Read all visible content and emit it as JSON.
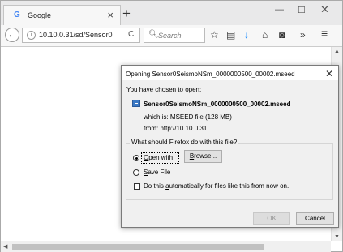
{
  "browser": {
    "tab": {
      "icon": "google-g-icon",
      "title": "Google"
    },
    "window_controls": [
      "minimize-icon",
      "maximize-icon",
      "close-icon"
    ],
    "url": "10.10.0.31/sd/Sensor0",
    "search_placeholder": "Search",
    "toolbar_icons": [
      "bookmark-star-icon",
      "reader-list-icon",
      "download-icon",
      "home-icon",
      "pocket-icon",
      "overflow-icon",
      "menu-icon"
    ]
  },
  "dialog": {
    "title": "Opening Sensor0SeismoNSm_0000000500_00002.mseed",
    "intro": "You have chosen to open:",
    "file_name": "Sensor0SeismoNSm_0000000500_00002.mseed",
    "which_is": "which is:  MSEED file (128 MB)",
    "from": "from:  http://10.10.0.31",
    "question": "What should Firefox do with this file?",
    "open_with": {
      "prefix": "",
      "underlined": "O",
      "rest": "pen with",
      "selected": true
    },
    "browse": {
      "prefix": "",
      "underlined": "B",
      "rest": "rowse..."
    },
    "save_file": {
      "prefix": "",
      "underlined": "S",
      "rest": "ave File",
      "selected": false
    },
    "auto": {
      "prefix": "Do this ",
      "underlined": "a",
      "rest": "utomatically for files like this from now on.",
      "checked": false
    },
    "ok_label": "OK",
    "cancel_label": "Cancel"
  },
  "colors": {
    "download_arrow": "#0a84ff",
    "dialog_border": "#7a7a7a"
  }
}
